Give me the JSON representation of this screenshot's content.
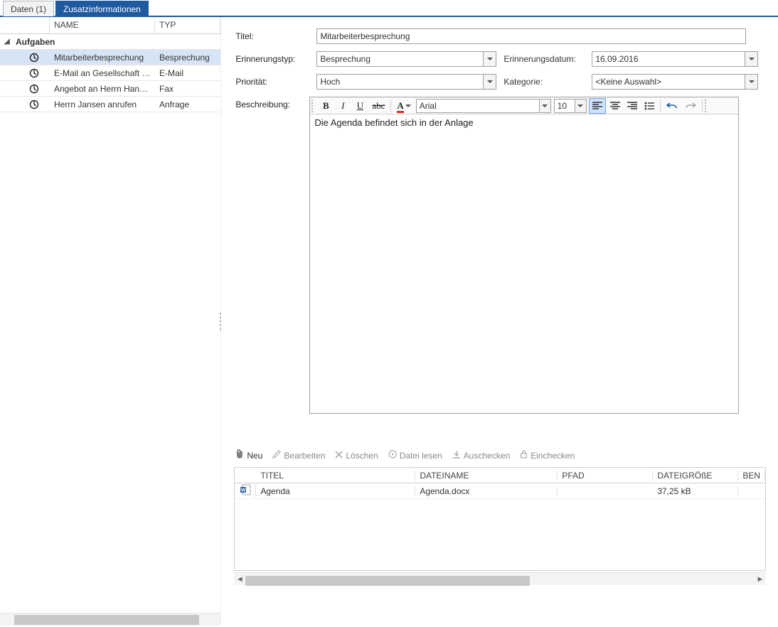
{
  "tabs": {
    "data": "Daten (1)",
    "zusatz": "Zusatzinformationen"
  },
  "sidebar": {
    "headers": {
      "name": "NAME",
      "typ": "TYP"
    },
    "group": "Aufgaben",
    "rows": [
      {
        "name": "Mitarbeiterbesprechung",
        "typ": "Besprechung",
        "selected": true
      },
      {
        "name": "E-Mail an Gesellschaft G...",
        "typ": "E-Mail",
        "selected": false
      },
      {
        "name": "Angebot an Herrn Hansen",
        "typ": "Fax",
        "selected": false
      },
      {
        "name": "Herrn Jansen anrufen",
        "typ": "Anfrage",
        "selected": false
      }
    ]
  },
  "form": {
    "labels": {
      "titel": "Titel:",
      "erinnerungstyp": "Erinnerungstyp:",
      "erinnerungsdatum": "Erinnerungsdatum:",
      "prioritaet": "Priorität:",
      "kategorie": "Kategorie:",
      "beschreibung": "Beschreibung:"
    },
    "values": {
      "titel": "Mitarbeiterbesprechung",
      "erinnerungstyp": "Besprechung",
      "erinnerungsdatum": "16.09.2016",
      "prioritaet": "Hoch",
      "kategorie": "<Keine Auswahl>"
    },
    "rt": {
      "font": "Arial",
      "size": "10",
      "text": "Die Agenda befindet sich in der Anlage"
    }
  },
  "attach": {
    "toolbar": {
      "neu": "Neu",
      "bearbeiten": "Bearbeiten",
      "loeschen": "Löschen",
      "datei_lesen": "Datei lesen",
      "auschecken": "Auschecken",
      "einchecken": "Einchecken"
    },
    "headers": {
      "titel": "TITEL",
      "dateiname": "DATEINAME",
      "pfad": "PFAD",
      "groesse": "DATEIGRÖßE",
      "ben": "BEN"
    },
    "rows": [
      {
        "titel": "Agenda",
        "dateiname": "Agenda.docx",
        "pfad": "",
        "groesse": "37,25 kB"
      }
    ]
  }
}
